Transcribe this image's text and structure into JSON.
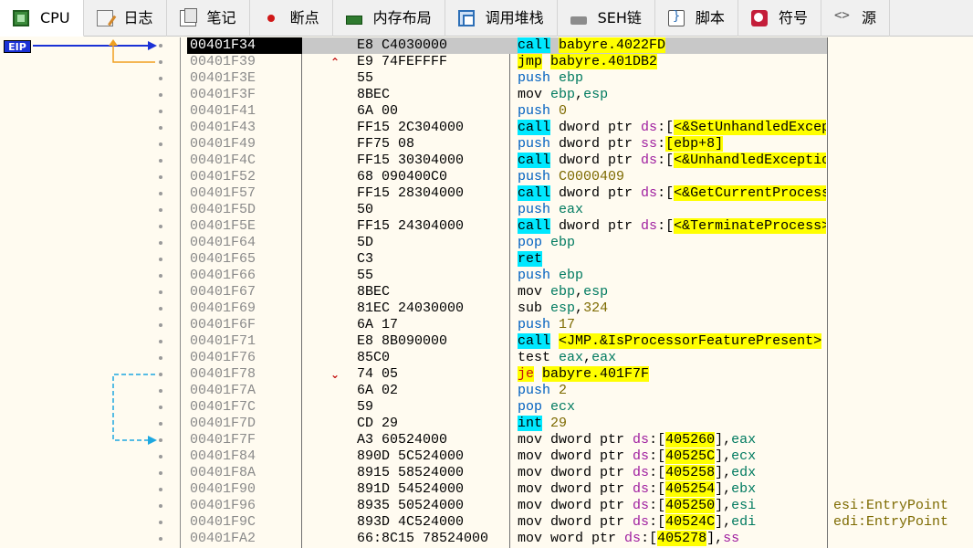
{
  "tabs": [
    {
      "label": "CPU",
      "icon": "cpu-icon",
      "active": true
    },
    {
      "label": "日志",
      "icon": "log-icon"
    },
    {
      "label": "笔记",
      "icon": "notes-icon"
    },
    {
      "label": "断点",
      "icon": "breakpoint-icon"
    },
    {
      "label": "内存布局",
      "icon": "memory-map-icon"
    },
    {
      "label": "调用堆栈",
      "icon": "call-stack-icon"
    },
    {
      "label": "SEH链",
      "icon": "seh-chain-icon"
    },
    {
      "label": "脚本",
      "icon": "script-icon"
    },
    {
      "label": "符号",
      "icon": "symbols-icon"
    },
    {
      "label": "源",
      "icon": "source-icon"
    }
  ],
  "eip_label": "EIP",
  "colors": {
    "call_highlight": "#00e8ff",
    "jump_highlight": "#ffff00",
    "eip_badge": "#1b32d6",
    "branch_arrow": "#1ea8e0",
    "address_text": "#8a8a8a"
  },
  "rows": [
    {
      "addr": "00401F34",
      "bytes": "E8 C4030000",
      "mn": "call",
      "kind": "call",
      "ops": [
        {
          "t": "babyre.4022FD",
          "c": "tgt-y"
        }
      ],
      "selected": true
    },
    {
      "addr": "00401F39",
      "bytes": "E9 74FEFFFF",
      "mn": "jmp",
      "kind": "jmp",
      "mark": "^",
      "ops": [
        {
          "t": "babyre.401DB2",
          "c": "tgt-y"
        }
      ]
    },
    {
      "addr": "00401F3E",
      "bytes": "55",
      "mn": "push",
      "kind": "push",
      "ops": [
        {
          "t": "ebp",
          "c": "reg"
        }
      ]
    },
    {
      "addr": "00401F3F",
      "bytes": "8BEC",
      "mn": "mov",
      "kind": "plain",
      "ops": [
        {
          "t": "ebp",
          "c": "reg"
        },
        {
          "t": ",",
          "c": "ptr"
        },
        {
          "t": "esp",
          "c": "reg"
        }
      ]
    },
    {
      "addr": "00401F41",
      "bytes": "6A 00",
      "mn": "push",
      "kind": "push",
      "ops": [
        {
          "t": "0",
          "c": "num"
        }
      ]
    },
    {
      "addr": "00401F43",
      "bytes": "FF15 2C304000",
      "mn": "call",
      "kind": "call",
      "ops": [
        {
          "t": "dword ptr ",
          "c": "ptr"
        },
        {
          "t": "ds",
          "c": "seg"
        },
        {
          "t": ":[",
          "c": "ptr"
        },
        {
          "t": "<&SetUnhandledExceptionFilter>",
          "c": "tgt-y"
        }
      ]
    },
    {
      "addr": "00401F49",
      "bytes": "FF75 08",
      "mn": "push",
      "kind": "push",
      "ops": [
        {
          "t": "dword ptr ",
          "c": "ptr"
        },
        {
          "t": "ss",
          "c": "seg"
        },
        {
          "t": ":",
          "c": "ptr"
        },
        {
          "t": "[",
          "c": "tgt-y"
        },
        {
          "t": "ebp+8",
          "c": "tgt-y"
        },
        {
          "t": "]",
          "c": "tgt-y"
        }
      ]
    },
    {
      "addr": "00401F4C",
      "bytes": "FF15 30304000",
      "mn": "call",
      "kind": "call",
      "ops": [
        {
          "t": "dword ptr ",
          "c": "ptr"
        },
        {
          "t": "ds",
          "c": "seg"
        },
        {
          "t": ":[",
          "c": "ptr"
        },
        {
          "t": "<&UnhandledExceptionFilter>",
          "c": "tgt-y"
        }
      ]
    },
    {
      "addr": "00401F52",
      "bytes": "68 090400C0",
      "mn": "push",
      "kind": "push",
      "ops": [
        {
          "t": "C0000409",
          "c": "num"
        }
      ]
    },
    {
      "addr": "00401F57",
      "bytes": "FF15 28304000",
      "mn": "call",
      "kind": "call",
      "ops": [
        {
          "t": "dword ptr ",
          "c": "ptr"
        },
        {
          "t": "ds",
          "c": "seg"
        },
        {
          "t": ":[",
          "c": "ptr"
        },
        {
          "t": "<&GetCurrentProcess>",
          "c": "tgt-y"
        }
      ]
    },
    {
      "addr": "00401F5D",
      "bytes": "50",
      "mn": "push",
      "kind": "push",
      "ops": [
        {
          "t": "eax",
          "c": "reg"
        }
      ]
    },
    {
      "addr": "00401F5E",
      "bytes": "FF15 24304000",
      "mn": "call",
      "kind": "call",
      "ops": [
        {
          "t": "dword ptr ",
          "c": "ptr"
        },
        {
          "t": "ds",
          "c": "seg"
        },
        {
          "t": ":[",
          "c": "ptr"
        },
        {
          "t": "<&TerminateProcess>",
          "c": "tgt-y"
        }
      ]
    },
    {
      "addr": "00401F64",
      "bytes": "5D",
      "mn": "pop",
      "kind": "pop",
      "ops": [
        {
          "t": "ebp",
          "c": "reg"
        }
      ]
    },
    {
      "addr": "00401F65",
      "bytes": "C3",
      "mn": "ret",
      "kind": "ret",
      "ops": []
    },
    {
      "addr": "00401F66",
      "bytes": "55",
      "mn": "push",
      "kind": "push",
      "ops": [
        {
          "t": "ebp",
          "c": "reg"
        }
      ]
    },
    {
      "addr": "00401F67",
      "bytes": "8BEC",
      "mn": "mov",
      "kind": "plain",
      "ops": [
        {
          "t": "ebp",
          "c": "reg"
        },
        {
          "t": ",",
          "c": "ptr"
        },
        {
          "t": "esp",
          "c": "reg"
        }
      ]
    },
    {
      "addr": "00401F69",
      "bytes": "81EC 24030000",
      "mn": "sub",
      "kind": "plain",
      "ops": [
        {
          "t": "esp",
          "c": "reg"
        },
        {
          "t": ",",
          "c": "ptr"
        },
        {
          "t": "324",
          "c": "num"
        }
      ]
    },
    {
      "addr": "00401F6F",
      "bytes": "6A 17",
      "mn": "push",
      "kind": "push",
      "ops": [
        {
          "t": "17",
          "c": "num"
        }
      ]
    },
    {
      "addr": "00401F71",
      "bytes": "E8 8B090000",
      "mn": "call",
      "kind": "call",
      "ops": [
        {
          "t": "<JMP.&IsProcessorFeaturePresent>",
          "c": "tgt-y"
        }
      ]
    },
    {
      "addr": "00401F76",
      "bytes": "85C0",
      "mn": "test",
      "kind": "plain",
      "ops": [
        {
          "t": "eax",
          "c": "reg"
        },
        {
          "t": ",",
          "c": "ptr"
        },
        {
          "t": "eax",
          "c": "reg"
        }
      ]
    },
    {
      "addr": "00401F78",
      "bytes": "74 05",
      "mn": "je",
      "kind": "jcc",
      "mark": "v",
      "ops": [
        {
          "t": "babyre.401F7F",
          "c": "tgt-y"
        }
      ]
    },
    {
      "addr": "00401F7A",
      "bytes": "6A 02",
      "mn": "push",
      "kind": "push",
      "ops": [
        {
          "t": "2",
          "c": "num"
        }
      ]
    },
    {
      "addr": "00401F7C",
      "bytes": "59",
      "mn": "pop",
      "kind": "pop",
      "ops": [
        {
          "t": "ecx",
          "c": "reg"
        }
      ]
    },
    {
      "addr": "00401F7D",
      "bytes": "CD 29",
      "mn": "int",
      "kind": "int",
      "ops": [
        {
          "t": "29",
          "c": "num"
        }
      ]
    },
    {
      "addr": "00401F7F",
      "bytes": "A3 60524000",
      "mn": "mov",
      "kind": "plain",
      "ops": [
        {
          "t": "dword ptr ",
          "c": "ptr"
        },
        {
          "t": "ds",
          "c": "seg"
        },
        {
          "t": ":[",
          "c": "ptr"
        },
        {
          "t": "405260",
          "c": "tgt-y"
        },
        {
          "t": "],",
          "c": "ptr"
        },
        {
          "t": "eax",
          "c": "reg"
        }
      ]
    },
    {
      "addr": "00401F84",
      "bytes": "890D 5C524000",
      "mn": "mov",
      "kind": "plain",
      "ops": [
        {
          "t": "dword ptr ",
          "c": "ptr"
        },
        {
          "t": "ds",
          "c": "seg"
        },
        {
          "t": ":[",
          "c": "ptr"
        },
        {
          "t": "40525C",
          "c": "tgt-y"
        },
        {
          "t": "],",
          "c": "ptr"
        },
        {
          "t": "ecx",
          "c": "reg"
        }
      ]
    },
    {
      "addr": "00401F8A",
      "bytes": "8915 58524000",
      "mn": "mov",
      "kind": "plain",
      "ops": [
        {
          "t": "dword ptr ",
          "c": "ptr"
        },
        {
          "t": "ds",
          "c": "seg"
        },
        {
          "t": ":[",
          "c": "ptr"
        },
        {
          "t": "405258",
          "c": "tgt-y"
        },
        {
          "t": "],",
          "c": "ptr"
        },
        {
          "t": "edx",
          "c": "reg"
        }
      ]
    },
    {
      "addr": "00401F90",
      "bytes": "891D 54524000",
      "mn": "mov",
      "kind": "plain",
      "ops": [
        {
          "t": "dword ptr ",
          "c": "ptr"
        },
        {
          "t": "ds",
          "c": "seg"
        },
        {
          "t": ":[",
          "c": "ptr"
        },
        {
          "t": "405254",
          "c": "tgt-y"
        },
        {
          "t": "],",
          "c": "ptr"
        },
        {
          "t": "ebx",
          "c": "reg"
        }
      ]
    },
    {
      "addr": "00401F96",
      "bytes": "8935 50524000",
      "mn": "mov",
      "kind": "plain",
      "ops": [
        {
          "t": "dword ptr ",
          "c": "ptr"
        },
        {
          "t": "ds",
          "c": "seg"
        },
        {
          "t": ":[",
          "c": "ptr"
        },
        {
          "t": "405250",
          "c": "tgt-y"
        },
        {
          "t": "],",
          "c": "ptr"
        },
        {
          "t": "esi",
          "c": "reg"
        }
      ],
      "comment": "esi:EntryPoint"
    },
    {
      "addr": "00401F9C",
      "bytes": "893D 4C524000",
      "mn": "mov",
      "kind": "plain",
      "ops": [
        {
          "t": "dword ptr ",
          "c": "ptr"
        },
        {
          "t": "ds",
          "c": "seg"
        },
        {
          "t": ":[",
          "c": "ptr"
        },
        {
          "t": "40524C",
          "c": "tgt-y"
        },
        {
          "t": "],",
          "c": "ptr"
        },
        {
          "t": "edi",
          "c": "reg"
        }
      ],
      "comment": "edi:EntryPoint"
    },
    {
      "addr": "00401FA2",
      "bytes": "66:8C15 78524000",
      "mn": "mov",
      "kind": "plain",
      "ops": [
        {
          "t": "word ptr ",
          "c": "ptr"
        },
        {
          "t": "ds",
          "c": "seg"
        },
        {
          "t": ":[",
          "c": "ptr"
        },
        {
          "t": "405278",
          "c": "tgt-y"
        },
        {
          "t": "],",
          "c": "ptr"
        },
        {
          "t": "ss",
          "c": "seg"
        }
      ]
    }
  ]
}
